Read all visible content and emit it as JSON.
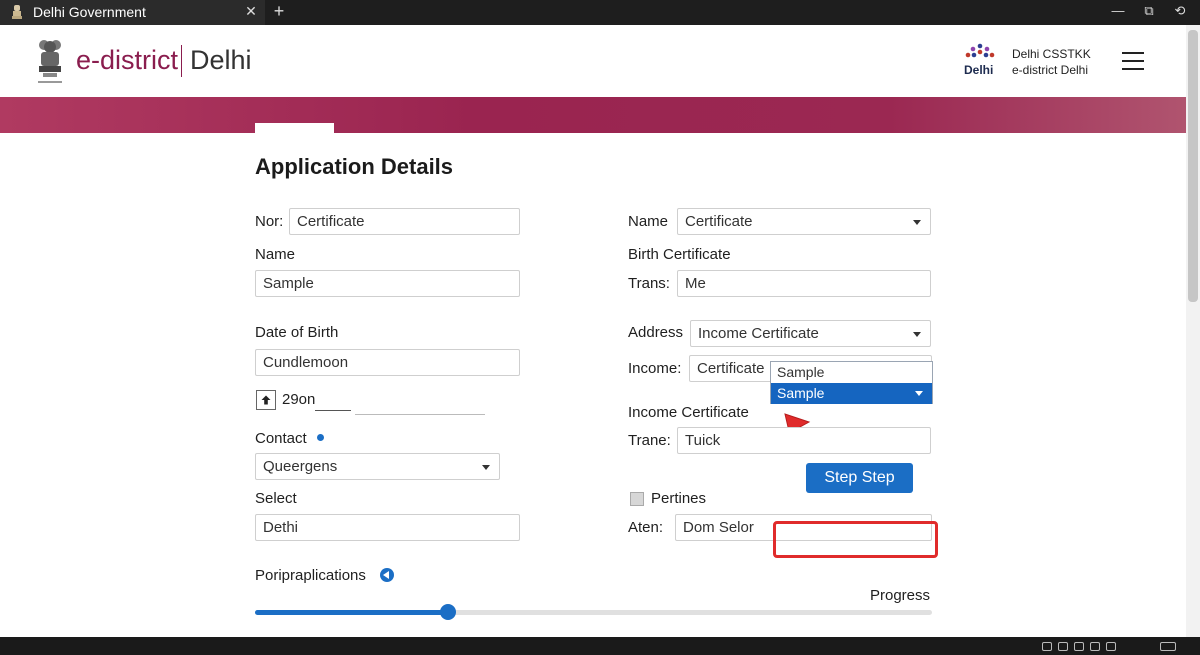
{
  "window": {
    "tab_title": "Delhi Government",
    "tab_close": "✕",
    "new_tab": "+",
    "minimize": "—",
    "restore": "⧉",
    "back": "⟲"
  },
  "header": {
    "brand": "e-district",
    "city": "Delhi",
    "logo_text": "Delhi",
    "right_line1": "Delhi CSSTKK",
    "right_line2": "e-district Delhi"
  },
  "form": {
    "title": "Application Details",
    "left": {
      "nor_label": "Nor:",
      "nor_value": "Certificate",
      "name_label": "Name",
      "name_value": "Sample",
      "dob_label": "Date of Birth",
      "dob_value": "Cundlemoon",
      "dob_text": "29on",
      "contact_label": "Contact",
      "contact_value": "Queergens",
      "select_label": "Select",
      "select_value": "Dethi",
      "poripr_label": "Poripraplications"
    },
    "right": {
      "name_label": "Name",
      "name_value": "Certificate",
      "birth_label": "Birth Certificate",
      "trans_label": "Trans:",
      "trans_value": "Me",
      "address_label": "Address",
      "address_value": "Income Certificate",
      "income_label": "Income:",
      "income_value": "Certificate",
      "dropdown_options": [
        "Sample",
        "Sample"
      ],
      "income_cert_label": "Income Certificate",
      "trane_label": "Trane:",
      "trane_value": "Tuick",
      "step_button": "Step Step",
      "pertines_label": "Pertines",
      "aten_label": "Aten:",
      "aten_value": "Dom Selor"
    },
    "progress_label": "Progress",
    "progress_fraction": 0.285
  },
  "colors": {
    "brand": "#8a1d4e",
    "accent": "#1b6ec5",
    "highlight": "#e02b2b"
  }
}
